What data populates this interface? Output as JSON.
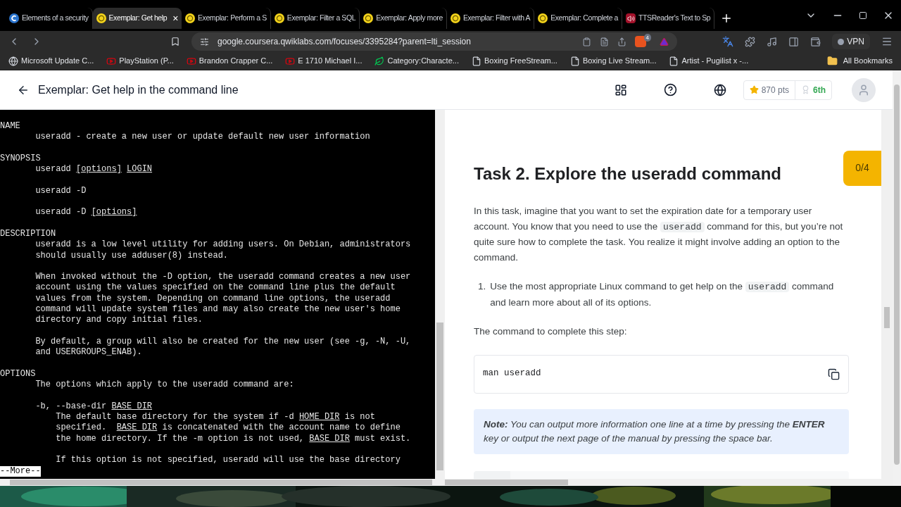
{
  "tabs": [
    {
      "title": "Elements of a security",
      "kind": "coursera",
      "selected": false
    },
    {
      "title": "Exemplar: Get help",
      "kind": "qwiklabs",
      "selected": true,
      "close": "×"
    },
    {
      "title": "Exemplar: Perform a S",
      "kind": "qwiklabs",
      "selected": false
    },
    {
      "title": "Exemplar: Filter a SQL",
      "kind": "qwiklabs",
      "selected": false
    },
    {
      "title": "Exemplar: Apply more",
      "kind": "qwiklabs",
      "selected": false
    },
    {
      "title": "Exemplar: Filter with A",
      "kind": "qwiklabs",
      "selected": false
    },
    {
      "title": "Exemplar: Complete a",
      "kind": "qwiklabs",
      "selected": false
    },
    {
      "title": "TTSReader's Text to Sp",
      "kind": "speaker",
      "selected": false
    }
  ],
  "address": {
    "url": "google.coursera.qwiklabs.com/focuses/3395284?parent=lti_session",
    "brave_count": "4",
    "vpn": "VPN"
  },
  "bookmarks": [
    {
      "label": "Microsoft Update C...",
      "kind": "globe"
    },
    {
      "label": "PlayStation (P...",
      "kind": "video"
    },
    {
      "label": "Brandon Crapper C...",
      "kind": "video"
    },
    {
      "label": "E 1710 Michael I...",
      "kind": "video"
    },
    {
      "label": "Category:Characte...",
      "kind": "leaf"
    },
    {
      "label": "Boxing FreeStream...",
      "kind": "page"
    },
    {
      "label": "Boxing Live Stream...",
      "kind": "page"
    },
    {
      "label": "Artist - Pugilist x -...",
      "kind": "page"
    }
  ],
  "all_bookmarks": "All Bookmarks",
  "header": {
    "title": "Exemplar: Get help in the command line",
    "points": "870 pts",
    "rank": "6th"
  },
  "terminal": {
    "paragraphs": [
      [
        "NAME",
        "       useradd - create a new user or update default new user information"
      ],
      [
        "SYNOPSIS",
        [
          {
            "t": "       useradd "
          },
          {
            "t": "[options]",
            "u": true
          },
          {
            "t": " LOGIN",
            "u": true
          }
        ]
      ],
      [
        "       useradd -D"
      ],
      [
        [
          {
            "t": "       useradd -D "
          },
          {
            "t": "[options]",
            "u": true
          }
        ]
      ],
      [
        "DESCRIPTION",
        "       useradd is a low level utility for adding users. On Debian, administrators",
        "       should usually use adduser(8) instead."
      ],
      [
        "       When invoked without the -D option, the useradd command creates a new user",
        "       account using the values specified on the command line plus the default",
        "       values from the system. Depending on command line options, the useradd",
        "       command will update system files and may also create the new user's home",
        "       directory and copy initial files."
      ],
      [
        "       By default, a group will also be created for the new user (see -g, -N, -U,",
        "       and USERGROUPS_ENAB)."
      ],
      [
        "OPTIONS",
        "       The options which apply to the useradd command are:"
      ],
      [
        [
          {
            "t": "       -b, --base-dir "
          },
          {
            "t": "BASE_DIR",
            "u": true
          }
        ],
        [
          {
            "t": "           The default base directory for the system if -d "
          },
          {
            "t": "HOME_DIR",
            "u": true
          },
          {
            "t": " is not"
          }
        ],
        [
          {
            "t": "           specified.  "
          },
          {
            "t": "BASE_DIR",
            "u": true
          },
          {
            "t": " is concatenated with the account name to define"
          }
        ],
        [
          {
            "t": "           the home directory. If the -m option is not used, "
          },
          {
            "t": "BASE_DIR",
            "u": true
          },
          {
            "t": " must exist."
          }
        ]
      ],
      [
        "           If this option is not specified, useradd will use the base directory"
      ]
    ],
    "prompt": "--More--"
  },
  "task": {
    "progress": "0/4",
    "heading": "Task 2. Explore the useradd command",
    "intro": [
      {
        "kind": "text",
        "t": "In this task, imagine that you want to set the expiration date for a temporary user account. You know that you need to use the "
      },
      {
        "kind": "code",
        "t": "useradd"
      },
      {
        "kind": "text",
        "t": " command for this, but you’re not quite sure how to complete the task. You realize it might involve adding an option to the command."
      }
    ],
    "steps": [
      {
        "number": "1.",
        "parts": [
          {
            "kind": "text",
            "t": "Use the most appropriate Linux command to get help on the "
          },
          {
            "kind": "code",
            "t": "useradd"
          },
          {
            "kind": "text",
            "t": " command and learn more about all of its options."
          }
        ]
      }
    ],
    "command_label": "The command to complete this step:",
    "command": "man useradd",
    "note": "**Note:** You can output more information one line at a time by pressing the **ENTER** key or output the next page of the manual by pressing the space bar."
  }
}
